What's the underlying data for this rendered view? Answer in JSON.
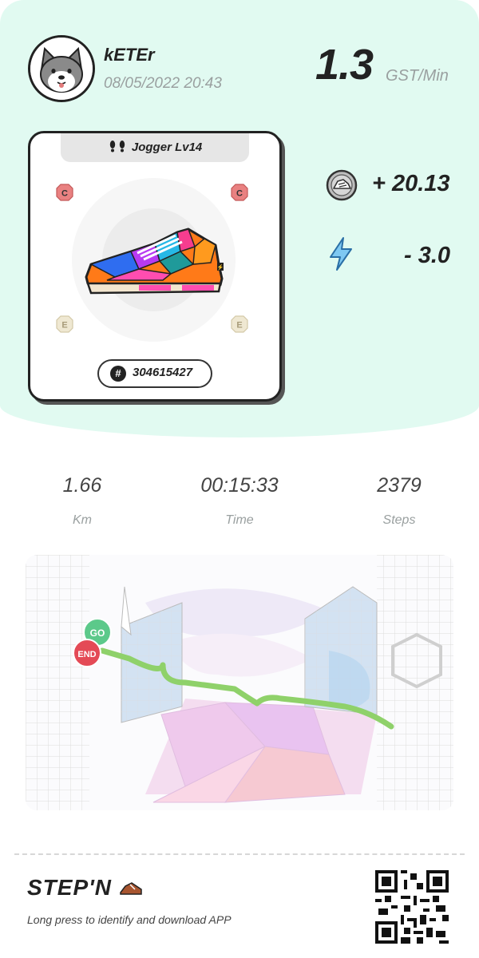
{
  "user": {
    "name": "kETEr",
    "datetime": "08/05/2022 20:43",
    "avatar_icon": "shiba-dog-avatar"
  },
  "earn_rate": {
    "value": "1.3",
    "unit": "GST/Min"
  },
  "sneaker": {
    "level_label": "Jogger Lv14",
    "type_icon": "footprints-icon",
    "token_id": "304615427",
    "token_prefix": "#",
    "gems": [
      {
        "slot": "top-left",
        "letter": "C",
        "color": "#e86a6a"
      },
      {
        "slot": "top-right",
        "letter": "C",
        "color": "#e86a6a"
      },
      {
        "slot": "bottom-left",
        "letter": "E",
        "color": "#e9e2c8"
      },
      {
        "slot": "bottom-right",
        "letter": "E",
        "color": "#e9e2c8"
      }
    ]
  },
  "reward": {
    "value": "+ 20.13",
    "icon": "gst-coin-icon"
  },
  "energy": {
    "value": "- 3.0",
    "icon": "lightning-icon",
    "color": "#7ec8f2"
  },
  "stats": [
    {
      "value": "1.66",
      "label": "Km"
    },
    {
      "value": "00:15:33",
      "label": "Time"
    },
    {
      "value": "2379",
      "label": "Steps"
    }
  ],
  "map": {
    "start_label": "GO",
    "end_label": "END",
    "route_color": "#8fd16a"
  },
  "footer": {
    "logo": "STEP'N",
    "hint": "Long press to identify and download APP",
    "qr_icon": "qr-code"
  },
  "colors": {
    "header_bg": "#e1faf1",
    "accent_dark": "#222222"
  }
}
